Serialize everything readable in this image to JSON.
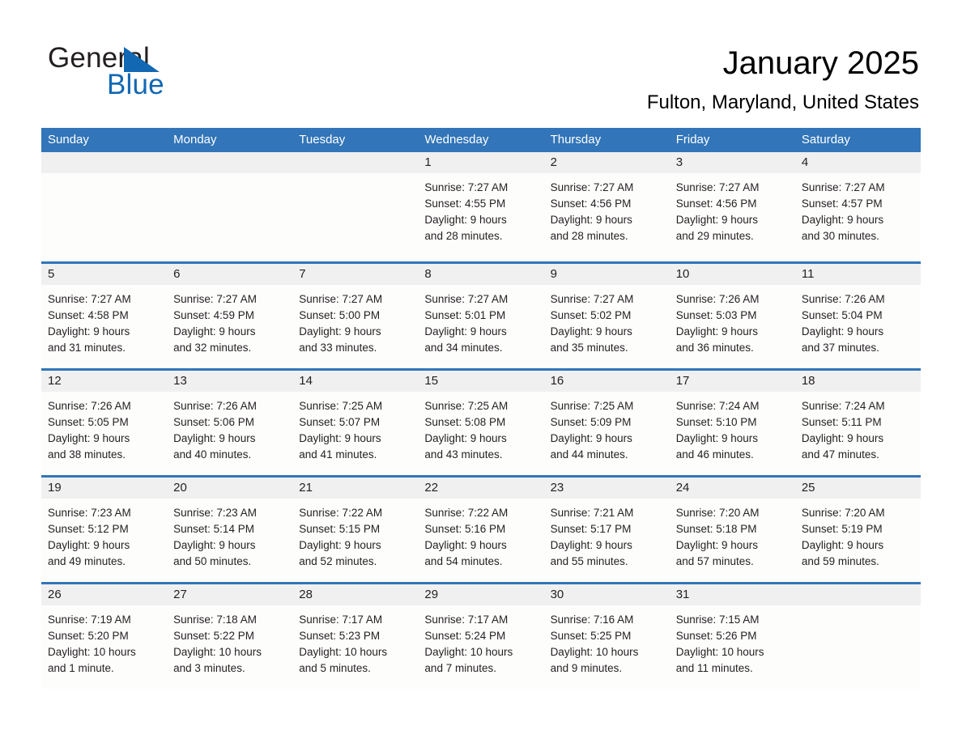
{
  "brand": {
    "name_part1": "General",
    "name_part2": "Blue",
    "accent_color": "#1268b3",
    "triangle_icon": "triangle-icon"
  },
  "header": {
    "title": "January 2025",
    "location": "Fulton, Maryland, United States"
  },
  "calendar": {
    "header_bg": "#3275b8",
    "header_text_color": "#ffffff",
    "row_divider_color": "#3275b8",
    "day_band_color": "#f0f0f0",
    "weekdays": [
      "Sunday",
      "Monday",
      "Tuesday",
      "Wednesday",
      "Thursday",
      "Friday",
      "Saturday"
    ],
    "weeks": [
      [
        {
          "day": "",
          "sunrise": "",
          "sunset": "",
          "daylight_line1": "",
          "daylight_line2": ""
        },
        {
          "day": "",
          "sunrise": "",
          "sunset": "",
          "daylight_line1": "",
          "daylight_line2": ""
        },
        {
          "day": "",
          "sunrise": "",
          "sunset": "",
          "daylight_line1": "",
          "daylight_line2": ""
        },
        {
          "day": "1",
          "sunrise": "Sunrise: 7:27 AM",
          "sunset": "Sunset: 4:55 PM",
          "daylight_line1": "Daylight: 9 hours",
          "daylight_line2": "and 28 minutes."
        },
        {
          "day": "2",
          "sunrise": "Sunrise: 7:27 AM",
          "sunset": "Sunset: 4:56 PM",
          "daylight_line1": "Daylight: 9 hours",
          "daylight_line2": "and 28 minutes."
        },
        {
          "day": "3",
          "sunrise": "Sunrise: 7:27 AM",
          "sunset": "Sunset: 4:56 PM",
          "daylight_line1": "Daylight: 9 hours",
          "daylight_line2": "and 29 minutes."
        },
        {
          "day": "4",
          "sunrise": "Sunrise: 7:27 AM",
          "sunset": "Sunset: 4:57 PM",
          "daylight_line1": "Daylight: 9 hours",
          "daylight_line2": "and 30 minutes."
        }
      ],
      [
        {
          "day": "5",
          "sunrise": "Sunrise: 7:27 AM",
          "sunset": "Sunset: 4:58 PM",
          "daylight_line1": "Daylight: 9 hours",
          "daylight_line2": "and 31 minutes."
        },
        {
          "day": "6",
          "sunrise": "Sunrise: 7:27 AM",
          "sunset": "Sunset: 4:59 PM",
          "daylight_line1": "Daylight: 9 hours",
          "daylight_line2": "and 32 minutes."
        },
        {
          "day": "7",
          "sunrise": "Sunrise: 7:27 AM",
          "sunset": "Sunset: 5:00 PM",
          "daylight_line1": "Daylight: 9 hours",
          "daylight_line2": "and 33 minutes."
        },
        {
          "day": "8",
          "sunrise": "Sunrise: 7:27 AM",
          "sunset": "Sunset: 5:01 PM",
          "daylight_line1": "Daylight: 9 hours",
          "daylight_line2": "and 34 minutes."
        },
        {
          "day": "9",
          "sunrise": "Sunrise: 7:27 AM",
          "sunset": "Sunset: 5:02 PM",
          "daylight_line1": "Daylight: 9 hours",
          "daylight_line2": "and 35 minutes."
        },
        {
          "day": "10",
          "sunrise": "Sunrise: 7:26 AM",
          "sunset": "Sunset: 5:03 PM",
          "daylight_line1": "Daylight: 9 hours",
          "daylight_line2": "and 36 minutes."
        },
        {
          "day": "11",
          "sunrise": "Sunrise: 7:26 AM",
          "sunset": "Sunset: 5:04 PM",
          "daylight_line1": "Daylight: 9 hours",
          "daylight_line2": "and 37 minutes."
        }
      ],
      [
        {
          "day": "12",
          "sunrise": "Sunrise: 7:26 AM",
          "sunset": "Sunset: 5:05 PM",
          "daylight_line1": "Daylight: 9 hours",
          "daylight_line2": "and 38 minutes."
        },
        {
          "day": "13",
          "sunrise": "Sunrise: 7:26 AM",
          "sunset": "Sunset: 5:06 PM",
          "daylight_line1": "Daylight: 9 hours",
          "daylight_line2": "and 40 minutes."
        },
        {
          "day": "14",
          "sunrise": "Sunrise: 7:25 AM",
          "sunset": "Sunset: 5:07 PM",
          "daylight_line1": "Daylight: 9 hours",
          "daylight_line2": "and 41 minutes."
        },
        {
          "day": "15",
          "sunrise": "Sunrise: 7:25 AM",
          "sunset": "Sunset: 5:08 PM",
          "daylight_line1": "Daylight: 9 hours",
          "daylight_line2": "and 43 minutes."
        },
        {
          "day": "16",
          "sunrise": "Sunrise: 7:25 AM",
          "sunset": "Sunset: 5:09 PM",
          "daylight_line1": "Daylight: 9 hours",
          "daylight_line2": "and 44 minutes."
        },
        {
          "day": "17",
          "sunrise": "Sunrise: 7:24 AM",
          "sunset": "Sunset: 5:10 PM",
          "daylight_line1": "Daylight: 9 hours",
          "daylight_line2": "and 46 minutes."
        },
        {
          "day": "18",
          "sunrise": "Sunrise: 7:24 AM",
          "sunset": "Sunset: 5:11 PM",
          "daylight_line1": "Daylight: 9 hours",
          "daylight_line2": "and 47 minutes."
        }
      ],
      [
        {
          "day": "19",
          "sunrise": "Sunrise: 7:23 AM",
          "sunset": "Sunset: 5:12 PM",
          "daylight_line1": "Daylight: 9 hours",
          "daylight_line2": "and 49 minutes."
        },
        {
          "day": "20",
          "sunrise": "Sunrise: 7:23 AM",
          "sunset": "Sunset: 5:14 PM",
          "daylight_line1": "Daylight: 9 hours",
          "daylight_line2": "and 50 minutes."
        },
        {
          "day": "21",
          "sunrise": "Sunrise: 7:22 AM",
          "sunset": "Sunset: 5:15 PM",
          "daylight_line1": "Daylight: 9 hours",
          "daylight_line2": "and 52 minutes."
        },
        {
          "day": "22",
          "sunrise": "Sunrise: 7:22 AM",
          "sunset": "Sunset: 5:16 PM",
          "daylight_line1": "Daylight: 9 hours",
          "daylight_line2": "and 54 minutes."
        },
        {
          "day": "23",
          "sunrise": "Sunrise: 7:21 AM",
          "sunset": "Sunset: 5:17 PM",
          "daylight_line1": "Daylight: 9 hours",
          "daylight_line2": "and 55 minutes."
        },
        {
          "day": "24",
          "sunrise": "Sunrise: 7:20 AM",
          "sunset": "Sunset: 5:18 PM",
          "daylight_line1": "Daylight: 9 hours",
          "daylight_line2": "and 57 minutes."
        },
        {
          "day": "25",
          "sunrise": "Sunrise: 7:20 AM",
          "sunset": "Sunset: 5:19 PM",
          "daylight_line1": "Daylight: 9 hours",
          "daylight_line2": "and 59 minutes."
        }
      ],
      [
        {
          "day": "26",
          "sunrise": "Sunrise: 7:19 AM",
          "sunset": "Sunset: 5:20 PM",
          "daylight_line1": "Daylight: 10 hours",
          "daylight_line2": "and 1 minute."
        },
        {
          "day": "27",
          "sunrise": "Sunrise: 7:18 AM",
          "sunset": "Sunset: 5:22 PM",
          "daylight_line1": "Daylight: 10 hours",
          "daylight_line2": "and 3 minutes."
        },
        {
          "day": "28",
          "sunrise": "Sunrise: 7:17 AM",
          "sunset": "Sunset: 5:23 PM",
          "daylight_line1": "Daylight: 10 hours",
          "daylight_line2": "and 5 minutes."
        },
        {
          "day": "29",
          "sunrise": "Sunrise: 7:17 AM",
          "sunset": "Sunset: 5:24 PM",
          "daylight_line1": "Daylight: 10 hours",
          "daylight_line2": "and 7 minutes."
        },
        {
          "day": "30",
          "sunrise": "Sunrise: 7:16 AM",
          "sunset": "Sunset: 5:25 PM",
          "daylight_line1": "Daylight: 10 hours",
          "daylight_line2": "and 9 minutes."
        },
        {
          "day": "31",
          "sunrise": "Sunrise: 7:15 AM",
          "sunset": "Sunset: 5:26 PM",
          "daylight_line1": "Daylight: 10 hours",
          "daylight_line2": "and 11 minutes."
        },
        {
          "day": "",
          "sunrise": "",
          "sunset": "",
          "daylight_line1": "",
          "daylight_line2": ""
        }
      ]
    ]
  }
}
